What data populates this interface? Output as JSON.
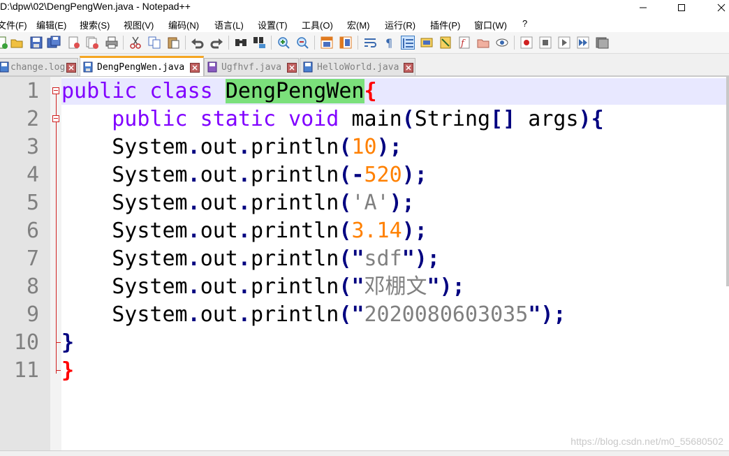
{
  "window": {
    "title": "D:\\dpw\\02\\DengPengWen.java - Notepad++"
  },
  "menu": [
    "文件(F)",
    "编辑(E)",
    "搜索(S)",
    "视图(V)",
    "编码(N)",
    "语言(L)",
    "设置(T)",
    "工具(O)",
    "宏(M)",
    "运行(R)",
    "插件(P)",
    "窗口(W)",
    "?"
  ],
  "toolbar_icons": [
    "new-file-icon",
    "open-file-icon",
    "save-icon",
    "save-all-icon",
    "close-icon",
    "close-all-icon",
    "print-icon",
    "cut-icon",
    "copy-icon",
    "paste-icon",
    "undo-icon",
    "redo-icon",
    "find-icon",
    "replace-icon",
    "zoom-in-icon",
    "zoom-out-icon",
    "sync-vertical-icon",
    "sync-horizontal-icon",
    "word-wrap-icon",
    "show-all-chars-icon",
    "indent-guide-icon",
    "doc-map-icon",
    "function-list-icon",
    "folder-workspace-icon",
    "monitoring-icon",
    "record-macro-icon",
    "stop-macro-icon",
    "play-macro-icon",
    "run-macro-multiple-icon",
    "save-macro-icon"
  ],
  "tabs": [
    {
      "label": "change.log",
      "active": false,
      "icon": "doc-icon"
    },
    {
      "label": "DengPengWen.java",
      "active": true,
      "icon": "save-doc-icon"
    },
    {
      "label": "Ugfhvf.java",
      "active": false,
      "icon": "save-doc-purple-icon"
    },
    {
      "label": "HelloWorld.java",
      "active": false,
      "icon": "save-doc-icon"
    }
  ],
  "editor": {
    "line_numbers": [
      "1",
      "2",
      "3",
      "4",
      "5",
      "6",
      "7",
      "8",
      "9",
      "10",
      "11"
    ],
    "lines": [
      [
        {
          "t": "public class ",
          "c": "kw"
        },
        {
          "t": "DengPengWen",
          "c": "cls"
        },
        {
          "t": "{",
          "c": "brace"
        }
      ],
      [
        {
          "t": "    "
        },
        {
          "t": "public static void ",
          "c": "kw"
        },
        {
          "t": "main"
        },
        {
          "t": "(",
          "c": "op"
        },
        {
          "t": "String"
        },
        {
          "t": "[]",
          "c": "op"
        },
        {
          "t": " args"
        },
        {
          "t": "){",
          "c": "op"
        }
      ],
      [
        {
          "t": "    System"
        },
        {
          "t": ".",
          "c": "op"
        },
        {
          "t": "out"
        },
        {
          "t": ".",
          "c": "op"
        },
        {
          "t": "println"
        },
        {
          "t": "(",
          "c": "op"
        },
        {
          "t": "10",
          "c": "num"
        },
        {
          "t": ");",
          "c": "op"
        }
      ],
      [
        {
          "t": "    System"
        },
        {
          "t": ".",
          "c": "op"
        },
        {
          "t": "out"
        },
        {
          "t": ".",
          "c": "op"
        },
        {
          "t": "println"
        },
        {
          "t": "(-",
          "c": "op"
        },
        {
          "t": "520",
          "c": "num"
        },
        {
          "t": ");",
          "c": "op"
        }
      ],
      [
        {
          "t": "    System"
        },
        {
          "t": ".",
          "c": "op"
        },
        {
          "t": "out"
        },
        {
          "t": ".",
          "c": "op"
        },
        {
          "t": "println"
        },
        {
          "t": "(",
          "c": "op"
        },
        {
          "t": "'A'",
          "c": "chr"
        },
        {
          "t": ");",
          "c": "op"
        }
      ],
      [
        {
          "t": "    System"
        },
        {
          "t": ".",
          "c": "op"
        },
        {
          "t": "out"
        },
        {
          "t": ".",
          "c": "op"
        },
        {
          "t": "println"
        },
        {
          "t": "(",
          "c": "op"
        },
        {
          "t": "3.14",
          "c": "num"
        },
        {
          "t": ");",
          "c": "op"
        }
      ],
      [
        {
          "t": "    System"
        },
        {
          "t": ".",
          "c": "op"
        },
        {
          "t": "out"
        },
        {
          "t": ".",
          "c": "op"
        },
        {
          "t": "println"
        },
        {
          "t": "(",
          "c": "op"
        },
        {
          "t": "\"",
          "c": "op"
        },
        {
          "t": "sdf",
          "c": "str"
        },
        {
          "t": "\"",
          "c": "op"
        },
        {
          "t": ");",
          "c": "op"
        }
      ],
      [
        {
          "t": "    System"
        },
        {
          "t": ".",
          "c": "op"
        },
        {
          "t": "out"
        },
        {
          "t": ".",
          "c": "op"
        },
        {
          "t": "println"
        },
        {
          "t": "(",
          "c": "op"
        },
        {
          "t": "\"",
          "c": "op"
        },
        {
          "t": "邓棚文",
          "c": "str"
        },
        {
          "t": "\"",
          "c": "op"
        },
        {
          "t": ");",
          "c": "op"
        }
      ],
      [
        {
          "t": "    System"
        },
        {
          "t": ".",
          "c": "op"
        },
        {
          "t": "out"
        },
        {
          "t": ".",
          "c": "op"
        },
        {
          "t": "println"
        },
        {
          "t": "(",
          "c": "op"
        },
        {
          "t": "\"",
          "c": "op"
        },
        {
          "t": "2020080603035",
          "c": "str"
        },
        {
          "t": "\"",
          "c": "op"
        },
        {
          "t": ");",
          "c": "op"
        }
      ],
      [
        {
          "t": "}",
          "c": "brace2"
        }
      ],
      [
        {
          "t": "}",
          "c": "brace"
        }
      ]
    ]
  },
  "watermark": "https://blog.csdn.net/m0_55680502"
}
